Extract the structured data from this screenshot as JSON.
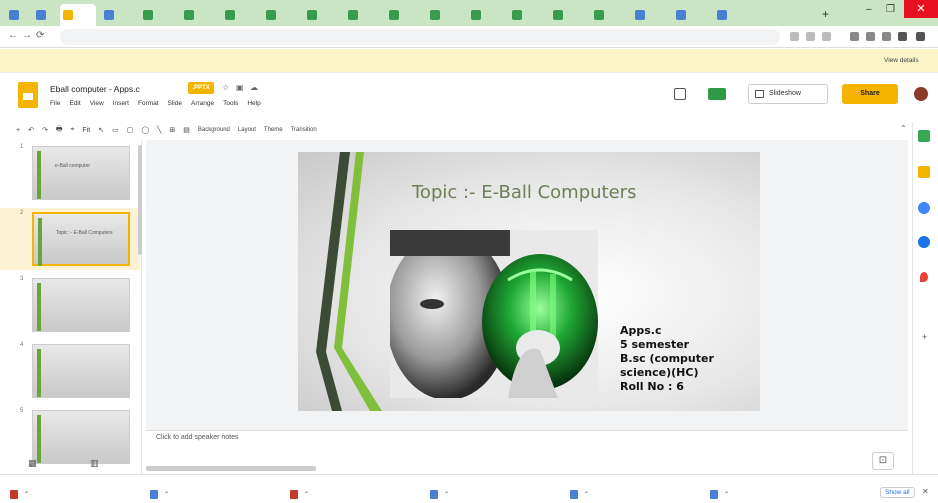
{
  "browser": {
    "tabs": [
      {
        "label": "",
        "color": "#4a7fd1"
      },
      {
        "label": "",
        "color": "#4a7fd1"
      },
      {
        "label": "",
        "color": "#f4b400",
        "active": true
      },
      {
        "label": "",
        "color": "#4a7fd1"
      },
      {
        "label": "",
        "color": "#3a9a50"
      },
      {
        "label": "",
        "color": "#3a9a50"
      },
      {
        "label": "",
        "color": "#3a9a50"
      },
      {
        "label": "",
        "color": "#3a9a50"
      },
      {
        "label": "",
        "color": "#3a9a50"
      },
      {
        "label": "",
        "color": "#3a9a50"
      },
      {
        "label": "",
        "color": "#3a9a50"
      },
      {
        "label": "",
        "color": "#3a9a50"
      },
      {
        "label": "",
        "color": "#3a9a50"
      },
      {
        "label": "",
        "color": "#3a9a50"
      },
      {
        "label": "",
        "color": "#3a9a50"
      },
      {
        "label": "",
        "color": "#3a9a50"
      },
      {
        "label": "",
        "color": "#4a7fd1"
      },
      {
        "label": "",
        "color": "#4a7fd1"
      },
      {
        "label": "",
        "color": "#4a7fd1"
      }
    ],
    "url": "",
    "new_tab": "+",
    "close": "✕"
  },
  "banner": {
    "message": "",
    "action": "View details"
  },
  "doc": {
    "title": "Eball computer - Apps.c",
    "badge": ".PPTX",
    "menu": [
      "File",
      "Edit",
      "View",
      "Insert",
      "Format",
      "Slide",
      "Arrange",
      "Tools",
      "Help"
    ],
    "last_edit": "",
    "present_label": "Slideshow",
    "share_label": "Share"
  },
  "toolbar": {
    "items": [
      "+",
      "↶",
      "↷",
      "🖶",
      "⌖",
      "Fit",
      "↖",
      "▭",
      "▢",
      "◯",
      "╲",
      "⊞",
      "▤"
    ],
    "text_items": [
      "Background",
      "Layout",
      "Theme",
      "Transition"
    ]
  },
  "slides": [
    {
      "num": "1",
      "title": "e-Ball computer",
      "selected": false
    },
    {
      "num": "2",
      "title": "Topic :- E-Ball Computers",
      "selected": true
    },
    {
      "num": "3",
      "title": "",
      "selected": false
    },
    {
      "num": "4",
      "title": "",
      "selected": false
    },
    {
      "num": "5",
      "title": "",
      "selected": false
    }
  ],
  "slide": {
    "title": "Topic :- E-Ball Computers",
    "info_lines": [
      "Apps.c",
      "5 semester",
      "B.sc (computer",
      "science)(HC)",
      "Roll No : 6"
    ]
  },
  "notes": {
    "placeholder": "Click to add speaker notes"
  },
  "downloads": [
    {
      "name": "",
      "color": "#c0392b"
    },
    {
      "name": "",
      "color": "#4a7fd1"
    },
    {
      "name": "",
      "color": "#c0392b"
    },
    {
      "name": "",
      "color": "#4a7fd1"
    },
    {
      "name": "",
      "color": "#4a7fd1"
    },
    {
      "name": "",
      "color": "#4a7fd1"
    }
  ],
  "shelf": {
    "show_all": "Show all",
    "close": "✕"
  },
  "colors": {
    "accent": "#f4b400",
    "tabstrip": "#c9e5c4",
    "banner": "#fdf5c8",
    "slide_green": "#6aa53c"
  }
}
